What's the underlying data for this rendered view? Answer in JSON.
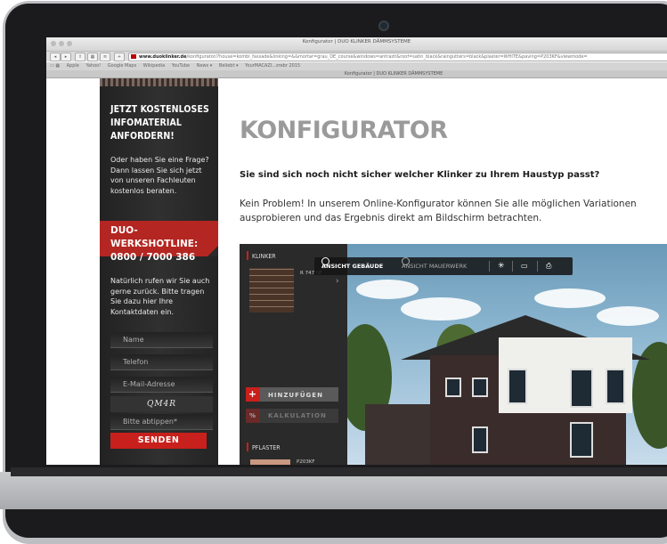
{
  "browser": {
    "window_title": "Konfigurator | DUO KLINKER DÄMMSYSTEME",
    "url_host": "www.duoklinker.de",
    "url_path": "/konfigurator/?house=kombi_fassade&linking=&&mortar=grau_DE_course&windows=antrazit&roof=satin_black&raingutters=black&plaster=WHITE&paving=P203KF&viewmode=",
    "bookmarks": [
      "Apple",
      "Yahoo!",
      "Google Maps",
      "Wikipedia",
      "YouTube",
      "News ▾",
      "Beliebt ▾",
      "YourMACAZI...zrebr 2015"
    ],
    "tab_title": "Konfigurator | DUO KLINKER DÄMMSYSTEME"
  },
  "sidebar": {
    "heading": "JETZT KOSTENLOSES INFOMATERIAL ANFORDERN!",
    "text1": "Oder haben Sie eine Frage? Dann lassen Sie sich jetzt von unseren Fachleuten kostenlos beraten.",
    "hotline_label": "DUO-WERKSHOTLINE:",
    "hotline_number": "0800 / 7000 386",
    "text2": "Natürlich rufen wir Sie auch gerne zurück. Bitte tragen Sie dazu hier Ihre Kontaktdaten ein.",
    "fields": {
      "name": "Name",
      "phone": "Telefon",
      "email": "E-Mail-Adresse",
      "captcha": "QM4R",
      "captcha_input": "Bitte abtippen*"
    },
    "send_label": "SENDEN"
  },
  "main": {
    "title": "KONFIGURATOR",
    "question": "Sie sind sich noch nicht sicher welcher Klinker zu Ihrem Haustyp passt?",
    "intro": "Kein Problem! In unserem Online-Konfigurator können Sie alle möglichen Variationen ausprobieren und das Ergebnis direkt am Bildschirm betrachten."
  },
  "configurator": {
    "klinker_label": "KLINKER",
    "klinker_code": "R 747 NF",
    "add_label": "HINZUFÜGEN",
    "calc_label": "KALKULATION",
    "pflaster_label": "PFLASTER",
    "pflaster_code": "P203KF",
    "view_building": "ANSICHT GEBÄUDE",
    "view_wall": "ANSICHT MAUERWERK",
    "icons": [
      "sun-icon",
      "image-icon",
      "print-icon"
    ]
  },
  "colors": {
    "accent_red": "#c8201c",
    "sidebar_bg": "#2a2a2a",
    "title_gray": "#9a9a9a"
  }
}
